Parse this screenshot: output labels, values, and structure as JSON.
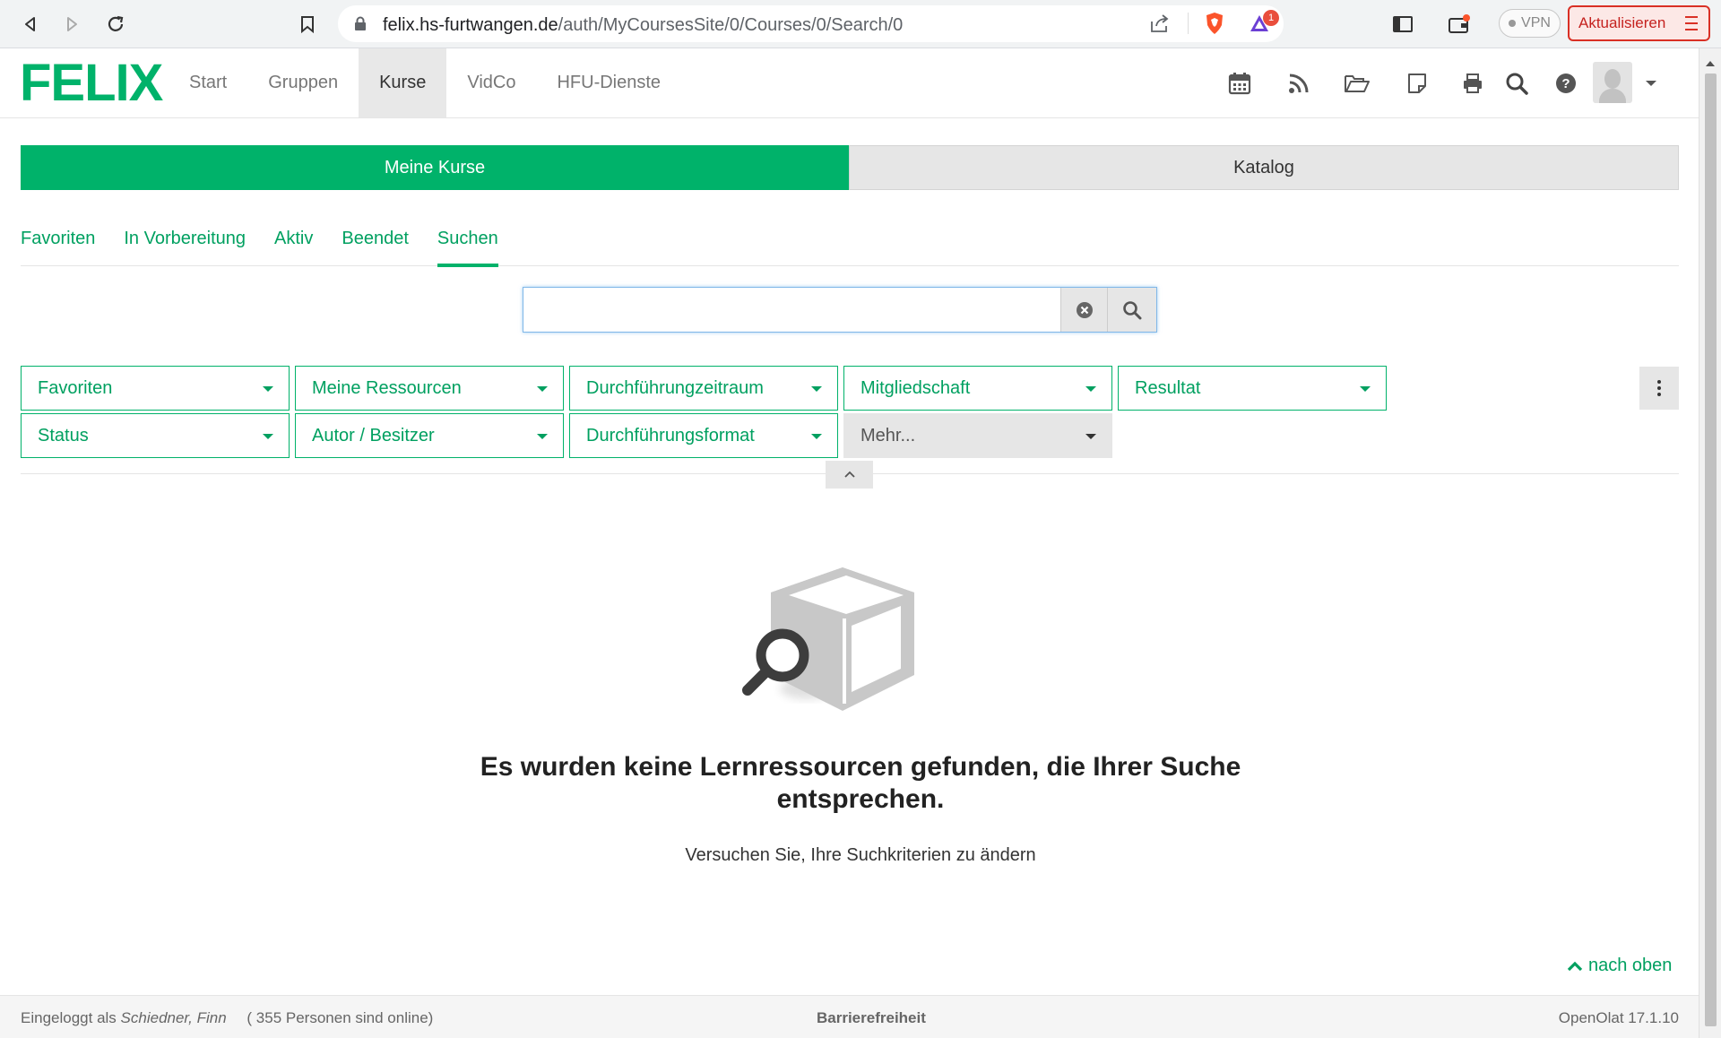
{
  "browser": {
    "url_host": "felix.hs-furtwangen.de",
    "url_path": "/auth/MyCoursesSite/0/Courses/0/Search/0",
    "vpn_label": "VPN",
    "update_label": "Aktualisieren",
    "notification_badge": "1",
    "accent_update": "#d93025"
  },
  "app": {
    "logo": "FELIX",
    "brand_color": "#00b26a",
    "nav": [
      "Start",
      "Gruppen",
      "Kurse",
      "VidCo",
      "HFU-Dienste"
    ],
    "active_nav": "Kurse",
    "tools": [
      "calendar-icon",
      "rss-icon",
      "folder-open-icon",
      "note-icon",
      "print-icon",
      "search-icon",
      "help-icon"
    ]
  },
  "segments": {
    "left": "Meine Kurse",
    "right": "Katalog"
  },
  "subtabs": [
    "Favoriten",
    "In Vorbereitung",
    "Aktiv",
    "Beendet",
    "Suchen"
  ],
  "active_subtab": "Suchen",
  "search": {
    "value": "",
    "placeholder": ""
  },
  "filters": {
    "row1": [
      "Favoriten",
      "Meine Ressourcen",
      "Durchführungzeitraum",
      "Mitgliedschaft",
      "Resultat"
    ],
    "row2": [
      "Status",
      "Autor / Besitzer",
      "Durchführungsformat"
    ],
    "more": "Mehr..."
  },
  "empty_state": {
    "title": "Es wurden keine Lernressourcen gefunden, die Ihrer Suche entsprechen.",
    "hint": "Versuchen Sie, Ihre Suchkriterien zu ändern"
  },
  "to_top": "nach oben",
  "footer": {
    "logged_in_prefix": "Eingeloggt als",
    "user": "Schiedner, Finn",
    "online": "( 355 Personen sind online)",
    "accessibility": "Barrierefreiheit",
    "version": "OpenOlat 17.1.10"
  }
}
